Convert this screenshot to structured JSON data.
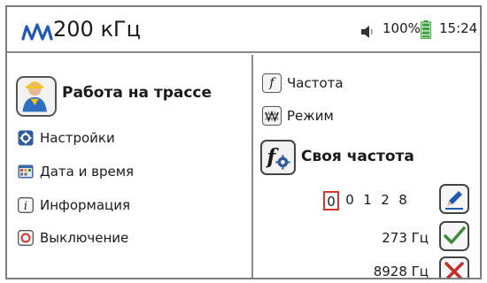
{
  "header": {
    "frequency_title": "200 кГц",
    "battery_percent": "100%",
    "time": "15:24",
    "icons": [
      "signal-wave-icon",
      "speaker-icon",
      "battery-icon"
    ]
  },
  "left_menu": {
    "title": "Работа на трассе",
    "items": [
      {
        "label": "Настройки",
        "icon": "gear-icon"
      },
      {
        "label": "Дата и время",
        "icon": "calendar-icon"
      },
      {
        "label": "Информация",
        "icon": "info-icon"
      },
      {
        "label": "Выключение",
        "icon": "power-icon"
      }
    ]
  },
  "right_panel": {
    "items": [
      {
        "label": "Частота",
        "icon": "f"
      },
      {
        "label": "Режим",
        "icon": "mode-icon"
      }
    ],
    "own_frequency": {
      "title": "Своя частота",
      "digits": [
        "0",
        "0",
        "1",
        "2",
        "8"
      ],
      "selected_digit_index": 0,
      "value_hz": "273 Гц",
      "value_result": "8928 Гц"
    },
    "actions": {
      "edit": "edit-pencil-icon",
      "confirm": "check-icon",
      "cancel": "cross-icon"
    },
    "colors": {
      "accent_blue": "#1f5bb5",
      "check_green": "#3d8a3a",
      "cross_red": "#c0302b",
      "battery_green": "#3aa53a",
      "selection_red": "#e0342a"
    }
  }
}
